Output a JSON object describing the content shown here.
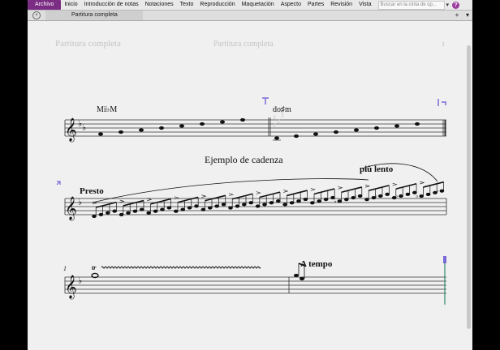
{
  "menu": {
    "file": "Archivo",
    "items": [
      "Inicio",
      "Introducción de notas",
      "Notaciones",
      "Texto",
      "Reproducción",
      "Maquetación",
      "Aspecto",
      "Partes",
      "Revisión",
      "Vista"
    ],
    "search_placeholder": "Buscar en la cinta de op..."
  },
  "tab": {
    "label": "Partitura completa"
  },
  "score": {
    "header_left": "Partitura completa",
    "header_center": "Partitura completa",
    "page_number": "1",
    "chord_1": "Mi♭M",
    "chord_2": "do♯m",
    "title_cadenza": "Ejemplo de cadenza",
    "tempo_presto": "Presto",
    "tempo_piu_lento": "più lento",
    "tempo_a_tempo": "A tempo",
    "measure_number": "1",
    "trill_label": "tr"
  },
  "colors": {
    "file_menu_bg": "#7b2c83",
    "selection": "#7a6bd9",
    "playback_line": "#2a8a6a"
  }
}
